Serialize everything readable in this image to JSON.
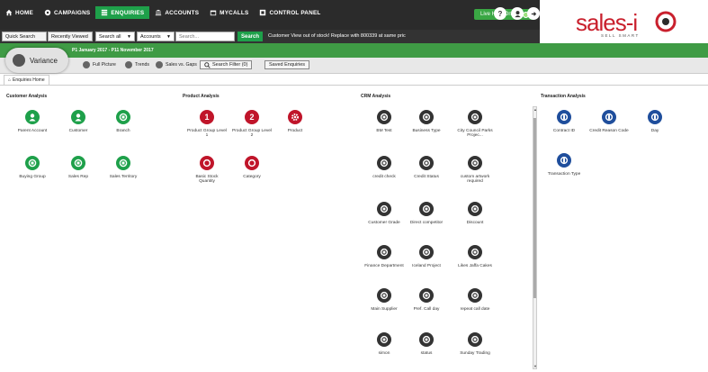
{
  "nav": {
    "items": [
      {
        "label": "HOME",
        "active": false
      },
      {
        "label": "CAMPAIGNS",
        "active": false
      },
      {
        "label": "ENQUIRIES",
        "active": true
      },
      {
        "label": "ACCOUNTS",
        "active": false
      },
      {
        "label": "MYCALLS",
        "active": false
      },
      {
        "label": "CONTROL PANEL",
        "active": false
      }
    ],
    "live_help": "Live Help Online"
  },
  "brand": {
    "logo": "sales-i",
    "tagline": "SELL SMART"
  },
  "search": {
    "quick_search": "Quick Search",
    "recently_viewed": "Recently Viewed",
    "scope": "Search all",
    "entity": "Accounts",
    "placeholder": "Search...",
    "go": "Search",
    "ticker": "Customer View  out of stock! Replace with 800339 at same pric"
  },
  "period": {
    "label": "P1 January 2017 - P11 November 2017"
  },
  "toolbar": {
    "variance": "Variance",
    "full_picture": "Full Picture",
    "trends": "Trends",
    "sales_vs_gaps": "Sales vs. Gaps",
    "search_filter": "Search Filter (0)",
    "saved_enquiries": "Saved Enquiries"
  },
  "tab": {
    "label": "Enquiries Home"
  },
  "sections": {
    "customer": {
      "title": "Customer Analysis",
      "tiles": [
        "Parent Account",
        "Customer",
        "Branch",
        "Buying Group",
        "Sales Rep",
        "Sales Territory"
      ]
    },
    "product": {
      "title": "Product Analysis",
      "tiles": [
        "Product Group Level 1",
        "Product Group Level 2",
        "Product",
        "Basic Stock Quantity",
        "Category"
      ]
    },
    "crm": {
      "title": "CRM Analysis",
      "tiles": [
        "BM Test",
        "Business Type",
        "City Council Parks Projec...",
        "credit check",
        "Credit Status",
        "custom artwork required",
        "Customer Grade",
        "Direct competitor",
        "Discount",
        "Finance Department",
        "Iceland Project",
        "Likes Jaffa Cakes",
        "Main Supplier",
        "Pref. Call day",
        "repeat call date",
        "simon",
        "status",
        "Sunday Trading"
      ]
    },
    "transaction": {
      "title": "Transaction Analysis",
      "tiles": [
        "Contract ID",
        "Credit Reason Code",
        "Day",
        "Transaction Type"
      ]
    }
  },
  "colors": {
    "green": "#1ea04a",
    "dark": "#2b2b2b",
    "red": "#c0152a",
    "navy": "#1f4e9c",
    "crm": "#333333",
    "brand": "#c9202d"
  }
}
